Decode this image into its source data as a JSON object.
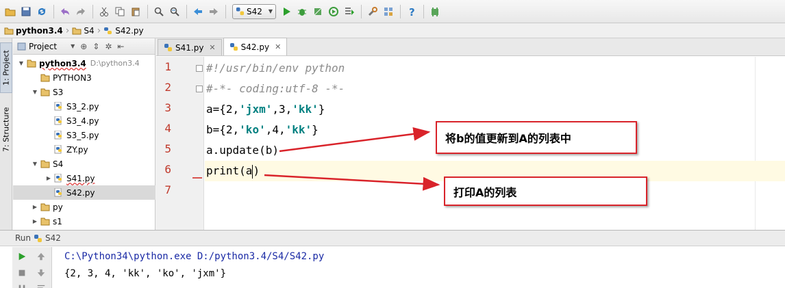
{
  "run_config": {
    "label": "S42"
  },
  "breadcrumb": [
    {
      "label": "python3.4",
      "bold": true,
      "icon": "folder-icon"
    },
    {
      "label": "S4",
      "bold": false,
      "icon": "folder-icon"
    },
    {
      "label": "S42.py",
      "bold": false,
      "icon": "python-file-icon"
    }
  ],
  "left_strip": {
    "project_tab": "1: Project",
    "structure_tab": "7: Structure"
  },
  "project_panel": {
    "title": "Project",
    "tree": [
      {
        "label": "python3.4",
        "path": "D:\\python3.4",
        "type": "folder",
        "indent": 0,
        "arrow": "down",
        "bold": true,
        "wavy": true
      },
      {
        "label": "PYTHON3",
        "type": "folder",
        "indent": 1,
        "arrow": ""
      },
      {
        "label": "S3",
        "type": "folder",
        "indent": 1,
        "arrow": "down"
      },
      {
        "label": "S3_2.py",
        "type": "py",
        "indent": 2,
        "arrow": ""
      },
      {
        "label": "S3_4.py",
        "type": "py",
        "indent": 2,
        "arrow": ""
      },
      {
        "label": "S3_5.py",
        "type": "py",
        "indent": 2,
        "arrow": ""
      },
      {
        "label": "ZY.py",
        "type": "py",
        "indent": 2,
        "arrow": ""
      },
      {
        "label": "S4",
        "type": "folder",
        "indent": 1,
        "arrow": "down"
      },
      {
        "label": "S41.py",
        "type": "py",
        "indent": 2,
        "arrow": "right",
        "wavy": true
      },
      {
        "label": "S42.py",
        "type": "py",
        "indent": 2,
        "arrow": "",
        "selected": true
      },
      {
        "label": "py",
        "type": "folder",
        "indent": 1,
        "arrow": "right"
      },
      {
        "label": "s1",
        "type": "folder",
        "indent": 1,
        "arrow": "right"
      }
    ]
  },
  "editor": {
    "tabs": [
      {
        "label": "S41.py",
        "active": false
      },
      {
        "label": "S42.py",
        "active": true
      }
    ],
    "lines": [
      {
        "num": "1",
        "text": "#!/usr/bin/env python"
      },
      {
        "num": "2",
        "text": "#-*- coding:utf-8 -*-"
      },
      {
        "num": "3",
        "p1": "a={2,",
        "s1": "'jxm'",
        "p2": ",3,",
        "s2": "'kk'",
        "p3": "}"
      },
      {
        "num": "4",
        "p1": "b={2,",
        "s1": "'ko'",
        "p2": ",4,",
        "s2": "'kk'",
        "p3": "}"
      },
      {
        "num": "5",
        "text": "a.update(b)"
      },
      {
        "num": "6",
        "before": "print(a",
        "after": ")"
      },
      {
        "num": "7"
      }
    ]
  },
  "annotations": {
    "update_note": "将b的值更新到A的列表中",
    "print_note": "打印A的列表"
  },
  "run_panel": {
    "title": "Run",
    "config": "S42",
    "command": "C:\\Python34\\python.exe D:/python3.4/S4/S42.py",
    "output": "{2, 3, 4, 'kk', 'ko', 'jxm'}"
  },
  "colors": {
    "line_number": "#c0392b",
    "string_literal": "#008080",
    "comment": "#8c8c8c",
    "annotation_border": "#d9232a",
    "console_command": "#1a2aa5",
    "current_line": "#fffae3"
  }
}
